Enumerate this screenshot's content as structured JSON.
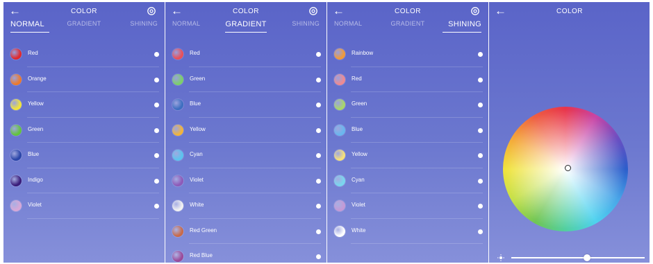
{
  "panels": [
    {
      "title": "COLOR",
      "tabs": [
        "NORMAL",
        "GRADIENT",
        "SHINING"
      ],
      "active_tab": 0,
      "items": [
        {
          "label": "Red",
          "color": "#e02a2e"
        },
        {
          "label": "Orange",
          "color": "#ec7a2c"
        },
        {
          "label": "Yellow",
          "color": "#f1e43a"
        },
        {
          "label": "Green",
          "color": "#63c43e"
        },
        {
          "label": "Blue",
          "color": "#2b46a8"
        },
        {
          "label": "Indigo",
          "color": "#3a1d7a"
        },
        {
          "label": "Violet",
          "color": "#d7a8d8"
        }
      ]
    },
    {
      "title": "COLOR",
      "tabs": [
        "NORMAL",
        "GRADIENT",
        "SHINING"
      ],
      "active_tab": 1,
      "items": [
        {
          "label": "Red",
          "color": "#e8505a"
        },
        {
          "label": "Green",
          "color": "#7ccf6a"
        },
        {
          "label": "Blue",
          "color": "#3e6ec0"
        },
        {
          "label": "Yellow",
          "color": "#f2b43a"
        },
        {
          "label": "Cyan",
          "color": "#5cc3ee"
        },
        {
          "label": "Violet",
          "color": "#8e5ab8"
        },
        {
          "label": "White",
          "color": "#f2f2f2"
        },
        {
          "label": "Red Green",
          "color": "#c86a4a"
        },
        {
          "label": "Red Blue",
          "color": "#9a4a9a"
        }
      ]
    },
    {
      "title": "COLOR",
      "tabs": [
        "NORMAL",
        "GRADIENT",
        "SHINING"
      ],
      "active_tab": 2,
      "items": [
        {
          "label": "Rainbow",
          "color": "#f09a3a"
        },
        {
          "label": "Red",
          "color": "#ee8a92"
        },
        {
          "label": "Green",
          "color": "#a8d66a"
        },
        {
          "label": "Blue",
          "color": "#6ab6ee"
        },
        {
          "label": "Yellow",
          "color": "#f6e07a"
        },
        {
          "label": "Cyan",
          "color": "#7ad6ee"
        },
        {
          "label": "Violet",
          "color": "#c49ad6"
        },
        {
          "label": "White",
          "color": "#ffffff"
        }
      ]
    }
  ],
  "wheel_panel": {
    "title": "COLOR",
    "brightness": 0.57
  }
}
